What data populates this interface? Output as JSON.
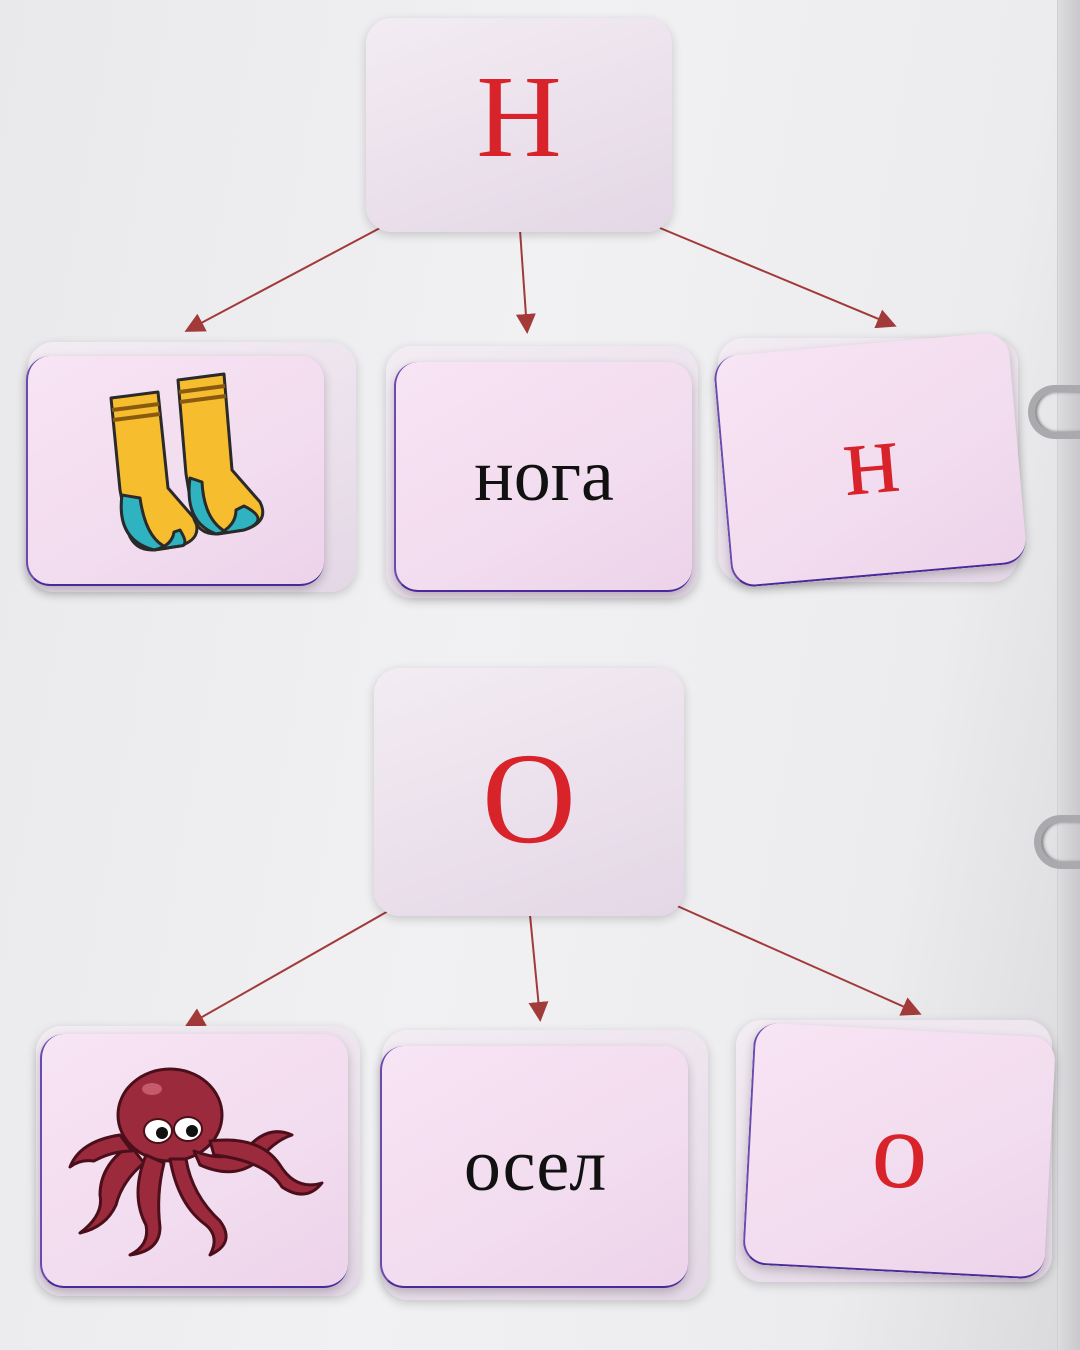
{
  "groups": [
    {
      "letter": "Н",
      "word": "нога",
      "lower_letter": "н",
      "picture": "socks-icon"
    },
    {
      "letter": "О",
      "word": "осел",
      "lower_letter": "о",
      "picture": "octopus-icon"
    }
  ],
  "colors": {
    "letter": "#d8232a",
    "word": "#111111",
    "card": "#f3def0",
    "arrow": "#a33a3a"
  }
}
